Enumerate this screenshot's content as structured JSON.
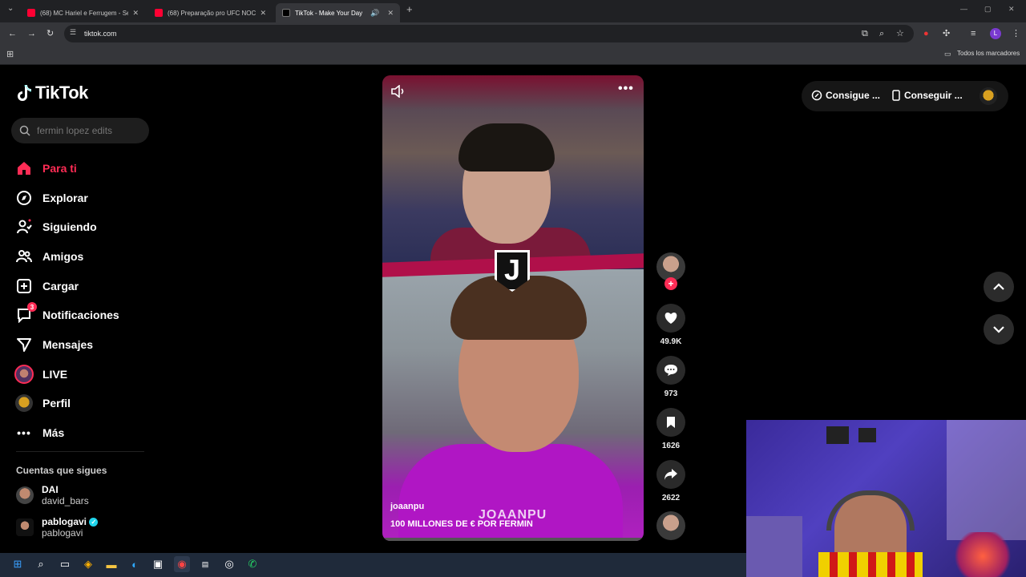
{
  "browser": {
    "tabs": [
      {
        "title": "(68) MC Hariel e Ferrugem - Se",
        "favicon_color": "#ff0033",
        "active": false
      },
      {
        "title": "(68) Preparação pro UFC NOCH",
        "favicon_color": "#ff0033",
        "active": false
      },
      {
        "title": "TikTok - Make Your Day",
        "favicon_color": "#000000",
        "active": true
      }
    ],
    "new_tab": "+",
    "url": "tiktok.com",
    "bookmarks_label": "Todos los marcadores"
  },
  "tiktok": {
    "logo_text": "TikTok",
    "search_placeholder": "fermin lopez edits",
    "nav": [
      {
        "label": "Para ti",
        "icon": "home-icon",
        "active": true
      },
      {
        "label": "Explorar",
        "icon": "compass-icon"
      },
      {
        "label": "Siguiendo",
        "icon": "following-icon"
      },
      {
        "label": "Amigos",
        "icon": "friends-icon"
      },
      {
        "label": "Cargar",
        "icon": "upload-icon"
      },
      {
        "label": "Notificaciones",
        "icon": "inbox-icon",
        "badge": "3"
      },
      {
        "label": "Mensajes",
        "icon": "send-icon"
      },
      {
        "label": "LIVE",
        "icon": "live-icon"
      },
      {
        "label": "Perfil",
        "icon": "profile-icon"
      },
      {
        "label": "Más",
        "icon": "more-dots-icon"
      }
    ],
    "following_title": "Cuentas que sigues",
    "following": [
      {
        "name": "DAI",
        "handle": "david_bars"
      },
      {
        "name": "pablogavi",
        "handle": "pablogavi",
        "verified": true
      }
    ],
    "video": {
      "author": "joaanpu",
      "description": "100 MILLONES DE € POR FERMIN",
      "watermark": "JOAANPU"
    },
    "actions": {
      "likes": "49.9K",
      "comments": "973",
      "saves": "1626",
      "shares": "2622"
    },
    "top_right": {
      "get_coins": "Consigue ...",
      "get_app": "Conseguir ..."
    }
  },
  "colors": {
    "accent": "#fe2c55"
  }
}
